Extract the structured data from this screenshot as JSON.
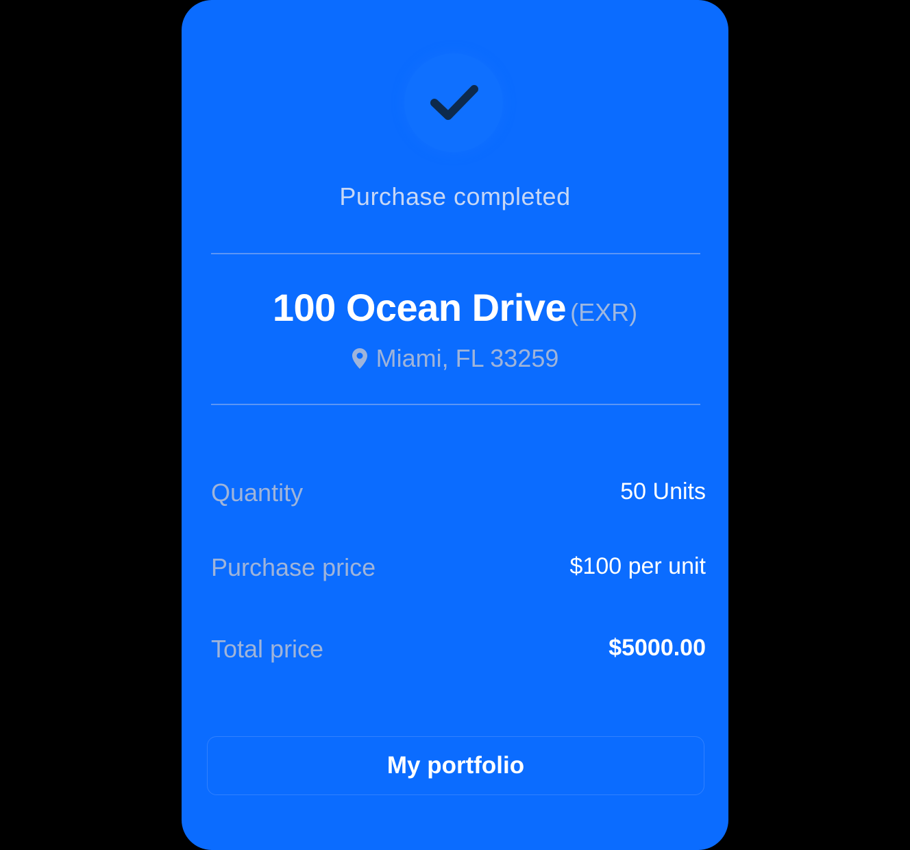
{
  "status": {
    "title": "Purchase completed",
    "icon": "checkmark-icon"
  },
  "property": {
    "name": "100 Ocean Drive",
    "ticker": "(EXR)",
    "location": "Miami, FL 33259",
    "location_icon": "map-pin-icon"
  },
  "details": [
    {
      "label": "Quantity",
      "value": "50 Units"
    },
    {
      "label": "Purchase price",
      "value": "$100 per unit"
    },
    {
      "label": "Total price",
      "value": "$5000.00"
    }
  ],
  "actions": {
    "portfolio_label": "My portfolio"
  },
  "colors": {
    "card_background": "#0b6cff",
    "check_color": "#0d2a4d",
    "text_primary": "#ffffff",
    "text_muted": "#9fb4da"
  }
}
